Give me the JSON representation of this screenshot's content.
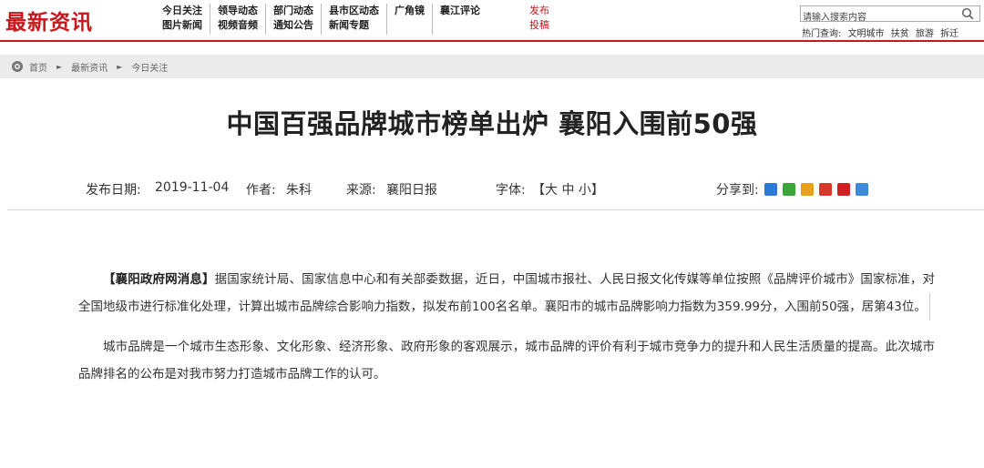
{
  "header": {
    "logo": "最新资讯",
    "nav": [
      [
        "今日关注",
        "图片新闻"
      ],
      [
        "领导动态",
        "视频音频"
      ],
      [
        "部门动态",
        "通知公告"
      ],
      [
        "县市区动态",
        "新闻专题"
      ],
      [
        "广角镜",
        ""
      ],
      [
        "襄江评论",
        ""
      ]
    ],
    "publish": [
      "发布",
      "投稿"
    ],
    "search_placeholder": "请输入搜索内容",
    "hot_label": "热门查询:",
    "hot_terms": [
      "文明城市",
      "扶贫",
      "旅游",
      "拆迁"
    ]
  },
  "breadcrumb": {
    "home": "首页",
    "level1": "最新资讯",
    "level2": "今日关注",
    "sep": "►"
  },
  "article": {
    "title": "中国百强品牌城市榜单出炉 襄阳入围前50强",
    "date_label": "发布日期:",
    "date": "2019-11-04",
    "author_label": "作者:",
    "author": "朱科",
    "source_label": "来源:",
    "source": "襄阳日报",
    "font_label": "字体:",
    "font_options": "【大 中 小】",
    "share_label": "分享到:",
    "share_icons": [
      "qzone-icon",
      "wechat-icon",
      "qq-space-icon",
      "weibo-icon",
      "renren-icon",
      "kaixin-icon"
    ],
    "share_colors": [
      "#2b7bd6",
      "#3aa63a",
      "#e8a11c",
      "#d6382e",
      "#d02020",
      "#3c8ad8"
    ],
    "p1_lead": "【襄阳政府网消息】",
    "p1_body": "据国家统计局、国家信息中心和有关部委数据，近日，中国城市报社、人民日报文化传媒等单位按照《品牌评价城市》国家标准，对全国地级市进行标准化处理，计算出城市品牌综合影响力指数，拟发布前100名名单。襄阳市的城市品牌影响力指数为359.99分，入围前50强，居第43位。",
    "p2": "城市品牌是一个城市生态形象、文化形象、经济形象、政府形象的客观展示，城市品牌的评价有利于城市竞争力的提升和人民生活质量的提高。此次城市品牌排名的公布是对我市努力打造城市品牌工作的认可。"
  }
}
